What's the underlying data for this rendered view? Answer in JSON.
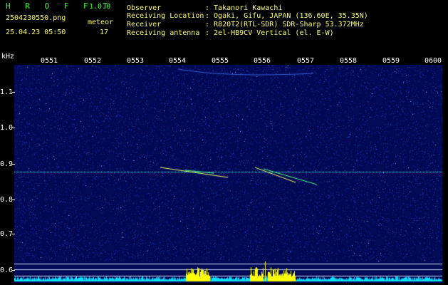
{
  "header": {
    "app_title": "H R O F F T",
    "app_version": "1.0.0",
    "file_name": "2504230550.png",
    "meteor_label": "meteor",
    "date_time": "25.04.23 05:50",
    "meteor_count": "17",
    "info": [
      {
        "label": "Observer",
        "value": ": Takanori Kawachi"
      },
      {
        "label": "Receiving Location",
        "value": ": Ogaki, Gifu, JAPAN (136.60E, 35.35N)"
      },
      {
        "label": "Receiver",
        "value": ": R820T2(RTL-SDR) SDR-Sharp 53.372MHz"
      },
      {
        "label": "Receiving antenna",
        "value": ": 2el-HB9CV Vertical (el. E-W)"
      }
    ]
  },
  "axes": {
    "freq_unit": "kHz",
    "time_labels": [
      "0551",
      "0552",
      "0553",
      "0554",
      "0555",
      "0556",
      "0557",
      "0558",
      "0559",
      "0600"
    ],
    "freq_labels": [
      "1.1",
      "1.0",
      "0.9",
      "0.8",
      "0.7",
      "0.6"
    ]
  },
  "colors": {
    "background": "#000000",
    "spectrogram_noise": "#0a1a8c",
    "carrier_line": "#33ffff",
    "power_bar": "#ffff00",
    "baseline": "#00e5ff"
  }
}
